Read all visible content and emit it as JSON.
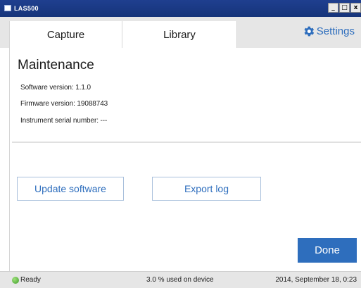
{
  "window": {
    "title": "LAS500",
    "controls": [
      "_",
      "□",
      "x"
    ]
  },
  "tabs": [
    {
      "label": "Capture",
      "icon": null
    },
    {
      "label": "Library",
      "icon": null
    }
  ],
  "settings": {
    "label": "Settings",
    "icon": "gear-icon",
    "color": "#2e6ebd"
  },
  "main": {
    "title": "Maintenance",
    "software_version": "Software version: 1.1.0",
    "firmware_version": "Firmware version: 19088743",
    "serial_number": "Instrument serial number: ---"
  },
  "buttons": {
    "update_software": "Update software",
    "export_log": "Export log",
    "done": "Done"
  },
  "status": {
    "state": "Ready",
    "state_icon": "status-ok-dot",
    "usage": "3.0 % used on device",
    "datetime": "2014, September 18, 0:23"
  },
  "colors": {
    "accent": "#2e6ebd",
    "titlebar": "#1f3f8f",
    "status_ok": "#5cb83a"
  }
}
